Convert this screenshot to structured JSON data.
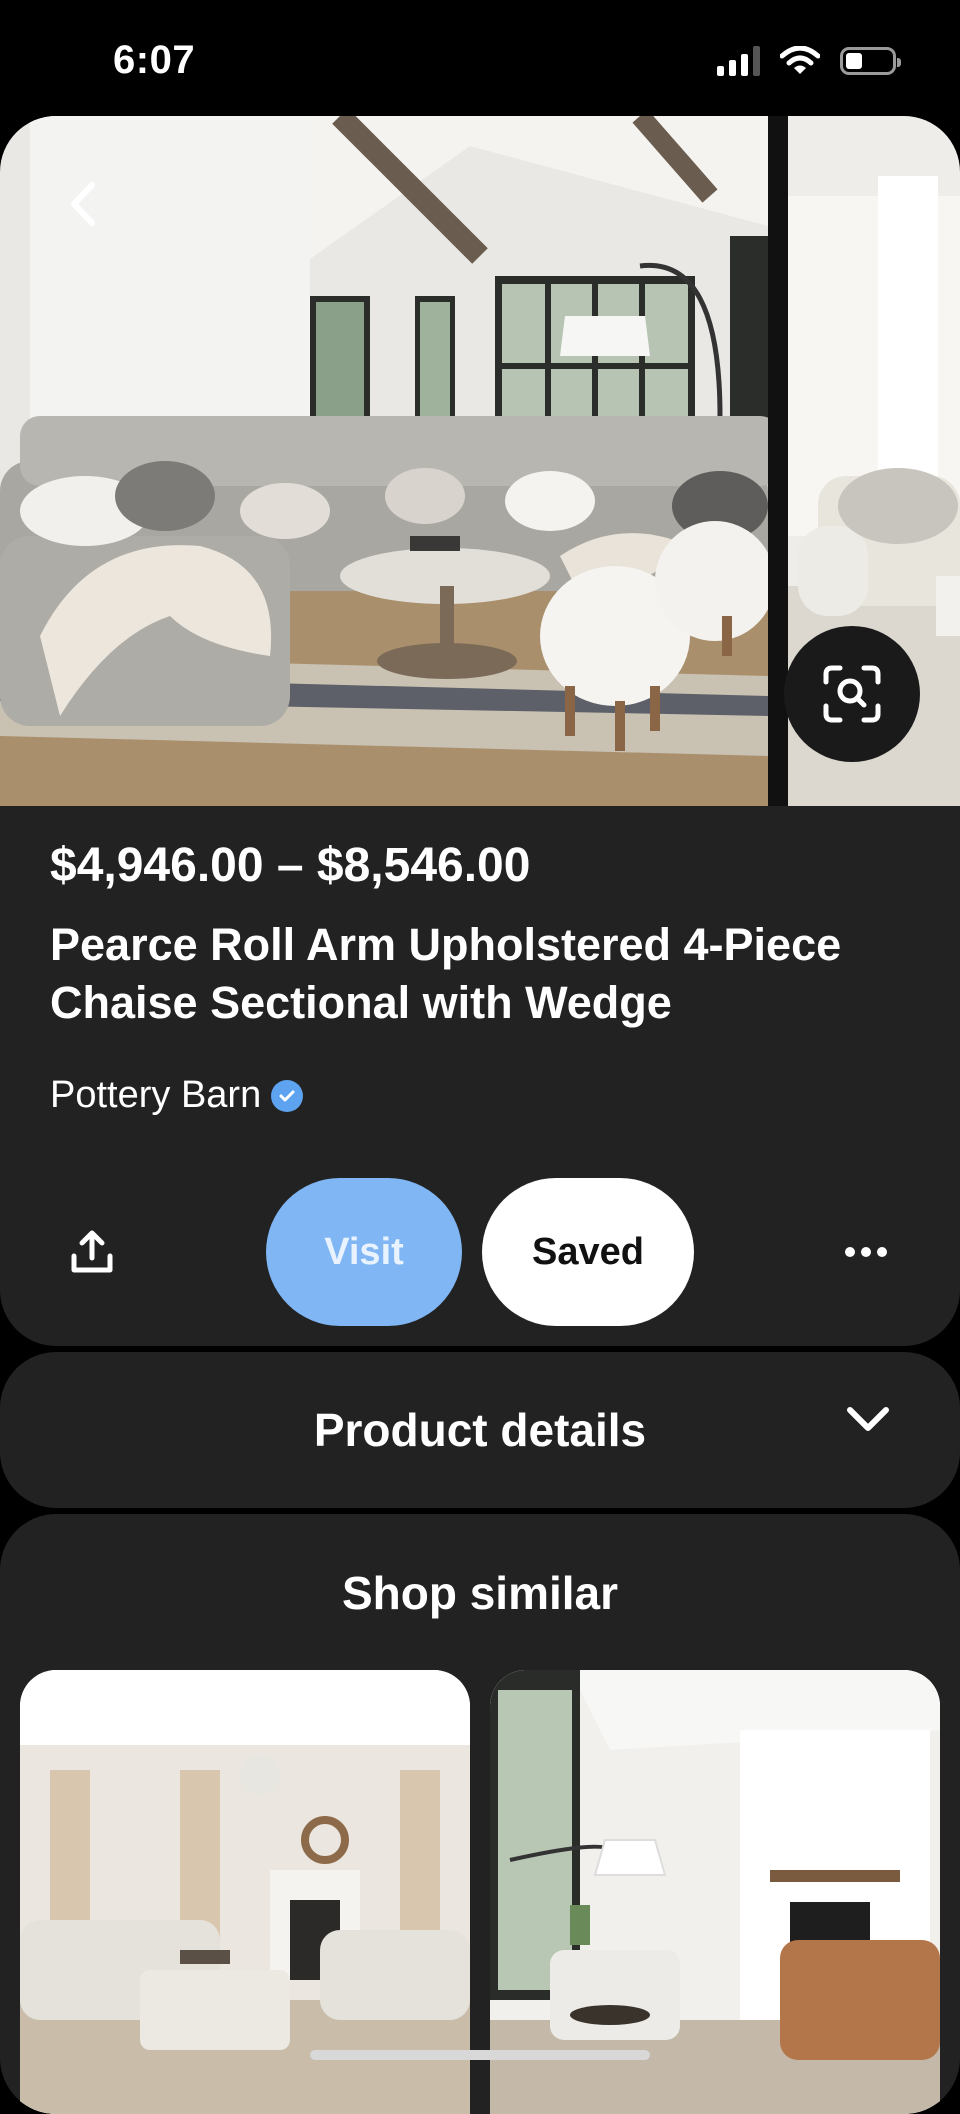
{
  "status_bar": {
    "time": "6:07",
    "icons": [
      "signal-icon",
      "wifi-icon",
      "battery-icon"
    ]
  },
  "product": {
    "price": "$4,946.00 – $8,546.00",
    "title": "Pearce Roll Arm Upholstered 4-Piece Chaise Sectional with Wedge",
    "brand": "Pottery Barn",
    "verified": true
  },
  "actions": {
    "visit_label": "Visit",
    "saved_label": "Saved"
  },
  "details": {
    "label": "Product details"
  },
  "similar": {
    "title": "Shop similar"
  },
  "colors": {
    "background": "#000000",
    "card": "#222222",
    "visit": "#7fb6f3",
    "saved": "#ffffff",
    "verified": "#5ea3f0"
  }
}
